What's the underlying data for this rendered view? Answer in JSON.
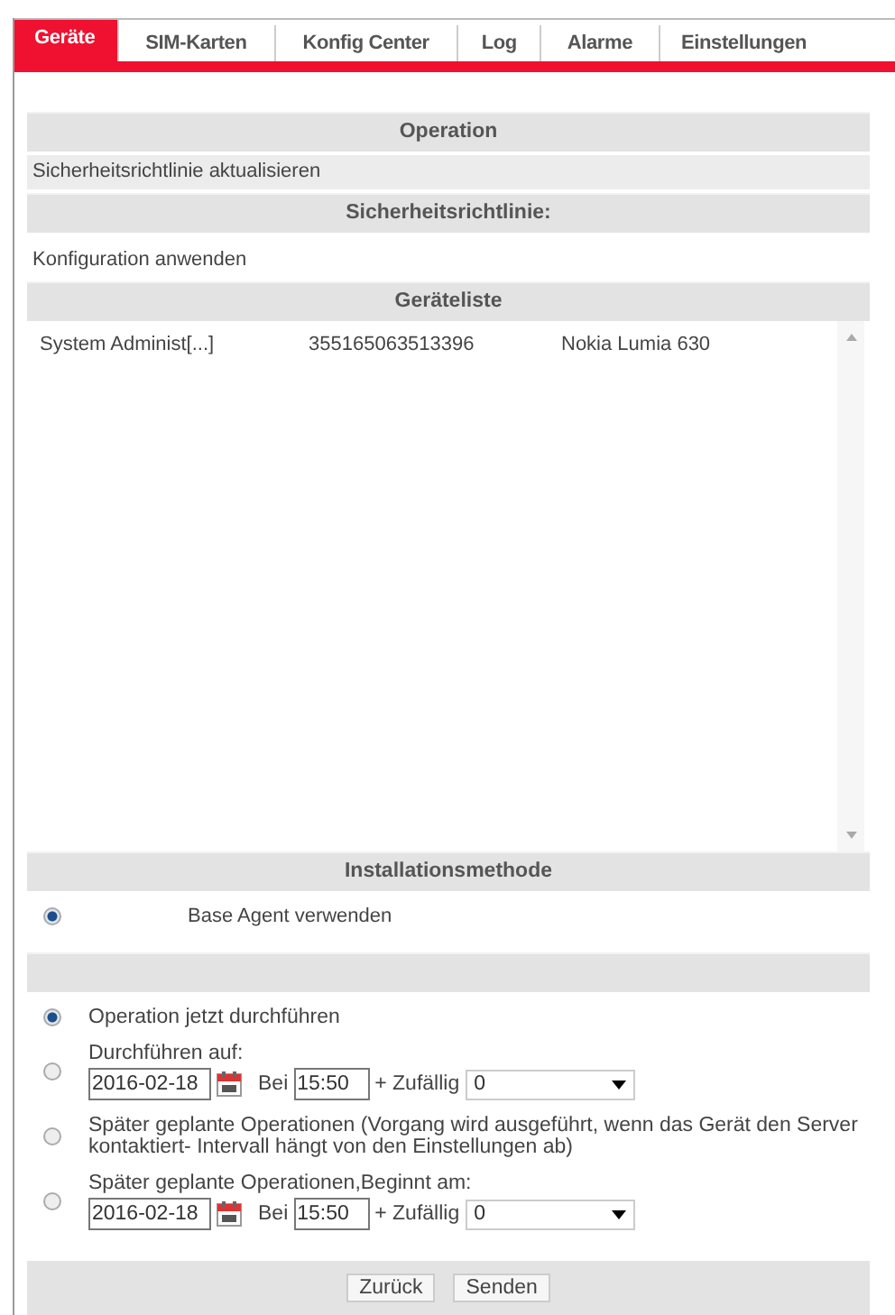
{
  "tabs": [
    {
      "label": "Geräte",
      "selected": true
    },
    {
      "label": "SIM-Karten",
      "selected": false
    },
    {
      "label": "Konfig Center",
      "selected": false
    },
    {
      "label": "Log",
      "selected": false
    },
    {
      "label": "Alarme",
      "selected": false
    },
    {
      "label": "Einstellungen",
      "selected": false
    }
  ],
  "operation": {
    "header": "Operation",
    "value": "Sicherheitsrichtlinie aktualisieren"
  },
  "policy": {
    "header": "Sicherheitsrichtlinie:",
    "value": "Konfiguration anwenden"
  },
  "device_list": {
    "header": "Geräteliste",
    "rows": [
      {
        "user": "System Administ[...]",
        "imei": "355165063513396",
        "model": "Nokia Lumia 630"
      }
    ]
  },
  "install": {
    "header": "Installationsmethode",
    "options": [
      {
        "label": "Base Agent verwenden",
        "selected": true
      }
    ]
  },
  "schedule": [
    {
      "kind": "plain",
      "label": "Operation jetzt durchführen",
      "selected": true
    },
    {
      "kind": "dated",
      "label": "Durchführen auf:",
      "selected": false,
      "date": "2016-02-18",
      "time_label": "Bei",
      "time": "15:50",
      "random_label": "+ Zufällig",
      "random": "0"
    },
    {
      "kind": "plain",
      "label": "Später geplante Operationen (Vorgang wird ausgeführt, wenn das Gerät den Server kontaktiert- Intervall hängt von den Einstellungen ab)",
      "selected": false
    },
    {
      "kind": "dated",
      "label": "Später geplante Operationen,Beginnt am:",
      "selected": false,
      "date": "2016-02-18",
      "time_label": "Bei",
      "time": "15:50",
      "random_label": "+ Zufällig",
      "random": "0"
    }
  ],
  "buttons": [
    "Zurück",
    "Senden"
  ]
}
